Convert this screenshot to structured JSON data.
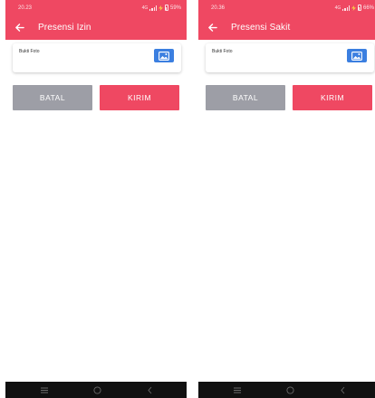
{
  "screens": [
    {
      "status": {
        "time": "20.23",
        "network": "4G",
        "battery": "59%"
      },
      "title": "Presensi Izin",
      "card": {
        "label": "Bukti Foto"
      },
      "buttons": {
        "cancel": "BATAL",
        "submit": "KIRIM"
      }
    },
    {
      "status": {
        "time": "20.36",
        "network": "4G",
        "battery": "66%"
      },
      "title": "Presensi Sakit",
      "card": {
        "label": "Bukti Foto"
      },
      "buttons": {
        "cancel": "BATAL",
        "submit": "KIRIM"
      }
    }
  ],
  "icons": {
    "back": "arrow-left-icon",
    "photo": "image-icon",
    "nav": [
      "menu-icon",
      "home-icon",
      "back-icon"
    ]
  },
  "colors": {
    "appbar": "#ef4862",
    "submit": "#ef4862",
    "cancel": "#9d9ea6",
    "photo_button": "#3b7fe0",
    "navbar": "#111111"
  }
}
